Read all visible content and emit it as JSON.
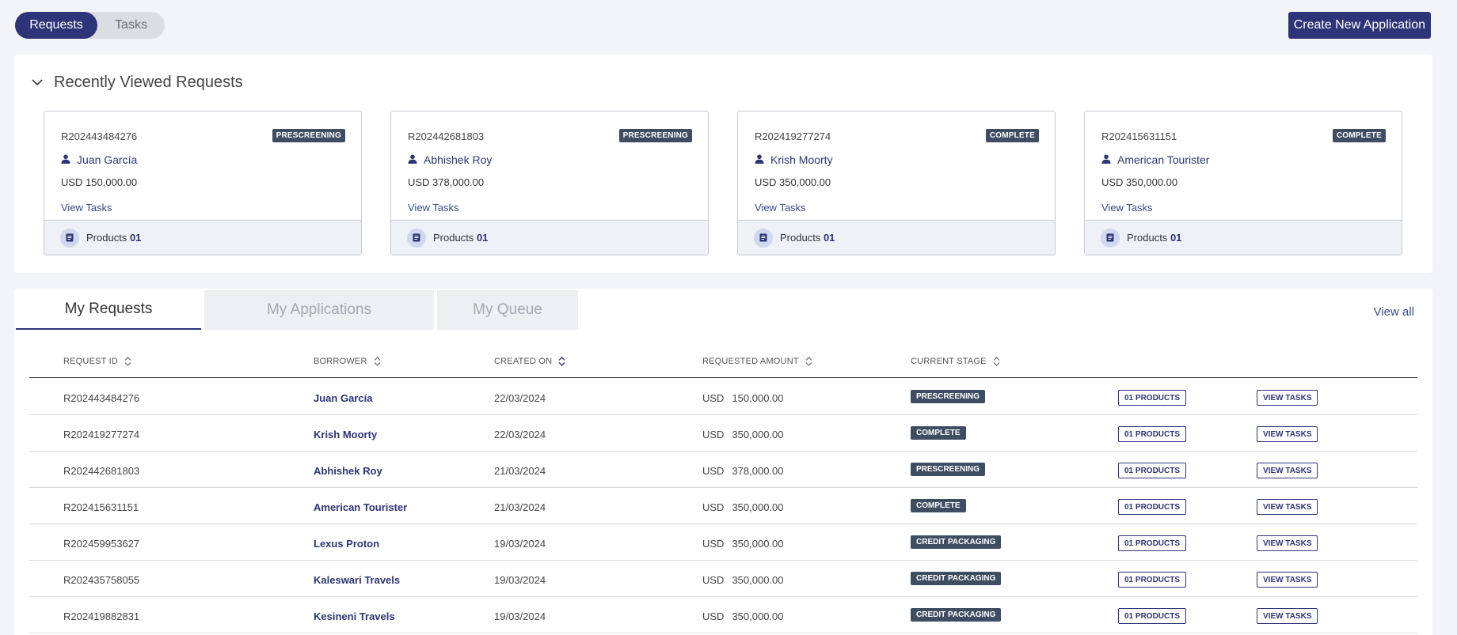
{
  "top": {
    "seg_requests": "Requests",
    "seg_tasks": "Tasks",
    "create_button": "Create New Application"
  },
  "recent": {
    "title": "Recently Viewed Requests",
    "cards": [
      {
        "id": "R202443484276",
        "stage": "PRESCREENING",
        "name": "Juan García",
        "amount": "USD 150,000.00",
        "link": "View Tasks",
        "products_label": "Products",
        "products_count": "01"
      },
      {
        "id": "R202442681803",
        "stage": "PRESCREENING",
        "name": "Abhishek Roy",
        "amount": "USD 378,000.00",
        "link": "View Tasks",
        "products_label": "Products",
        "products_count": "01"
      },
      {
        "id": "R202419277274",
        "stage": "COMPLETE",
        "name": "Krish Moorty",
        "amount": "USD 350,000.00",
        "link": "View Tasks",
        "products_label": "Products",
        "products_count": "01"
      },
      {
        "id": "R202415631151",
        "stage": "COMPLETE",
        "name": "American Tourister",
        "amount": "USD 350,000.00",
        "link": "View Tasks",
        "products_label": "Products",
        "products_count": "01"
      }
    ]
  },
  "table": {
    "tabs": [
      "My Requests",
      "My Applications",
      "My Queue"
    ],
    "view_all": "View all",
    "headers": [
      "REQUEST ID",
      "BORROWER",
      "CREATED ON",
      "REQUESTED AMOUNT",
      "CURRENT STAGE"
    ],
    "rows": [
      {
        "id": "R202443484276",
        "borrower": "Juan García",
        "created": "22/03/2024",
        "currency": "USD",
        "amount": "150,000.00",
        "stage": "PRESCREENING",
        "products": "01 PRODUCTS",
        "tasks": "VIEW TASKS"
      },
      {
        "id": "R202419277274",
        "borrower": "Krish Moorty",
        "created": "22/03/2024",
        "currency": "USD",
        "amount": "350,000.00",
        "stage": "COMPLETE",
        "products": "01 PRODUCTS",
        "tasks": "VIEW TASKS"
      },
      {
        "id": "R202442681803",
        "borrower": "Abhishek Roy",
        "created": "21/03/2024",
        "currency": "USD",
        "amount": "378,000.00",
        "stage": "PRESCREENING",
        "products": "01 PRODUCTS",
        "tasks": "VIEW TASKS"
      },
      {
        "id": "R202415631151",
        "borrower": "American Tourister",
        "created": "21/03/2024",
        "currency": "USD",
        "amount": "350,000.00",
        "stage": "COMPLETE",
        "products": "01 PRODUCTS",
        "tasks": "VIEW TASKS"
      },
      {
        "id": "R202459953627",
        "borrower": "Lexus Proton",
        "created": "19/03/2024",
        "currency": "USD",
        "amount": "350,000.00",
        "stage": "CREDIT PACKAGING",
        "products": "01 PRODUCTS",
        "tasks": "VIEW TASKS"
      },
      {
        "id": "R202435758055",
        "borrower": "Kaleswari Travels",
        "created": "19/03/2024",
        "currency": "USD",
        "amount": "350,000.00",
        "stage": "CREDIT PACKAGING",
        "products": "01 PRODUCTS",
        "tasks": "VIEW TASKS"
      },
      {
        "id": "R202419882831",
        "borrower": "Kesineni Travels",
        "created": "19/03/2024",
        "currency": "USD",
        "amount": "350,000.00",
        "stage": "CREDIT PACKAGING",
        "products": "01 PRODUCTS",
        "tasks": "VIEW TASKS"
      }
    ]
  },
  "colors": {
    "primary": "#2d3478",
    "badge": "#3f4d63",
    "background": "#f3f4f7"
  }
}
